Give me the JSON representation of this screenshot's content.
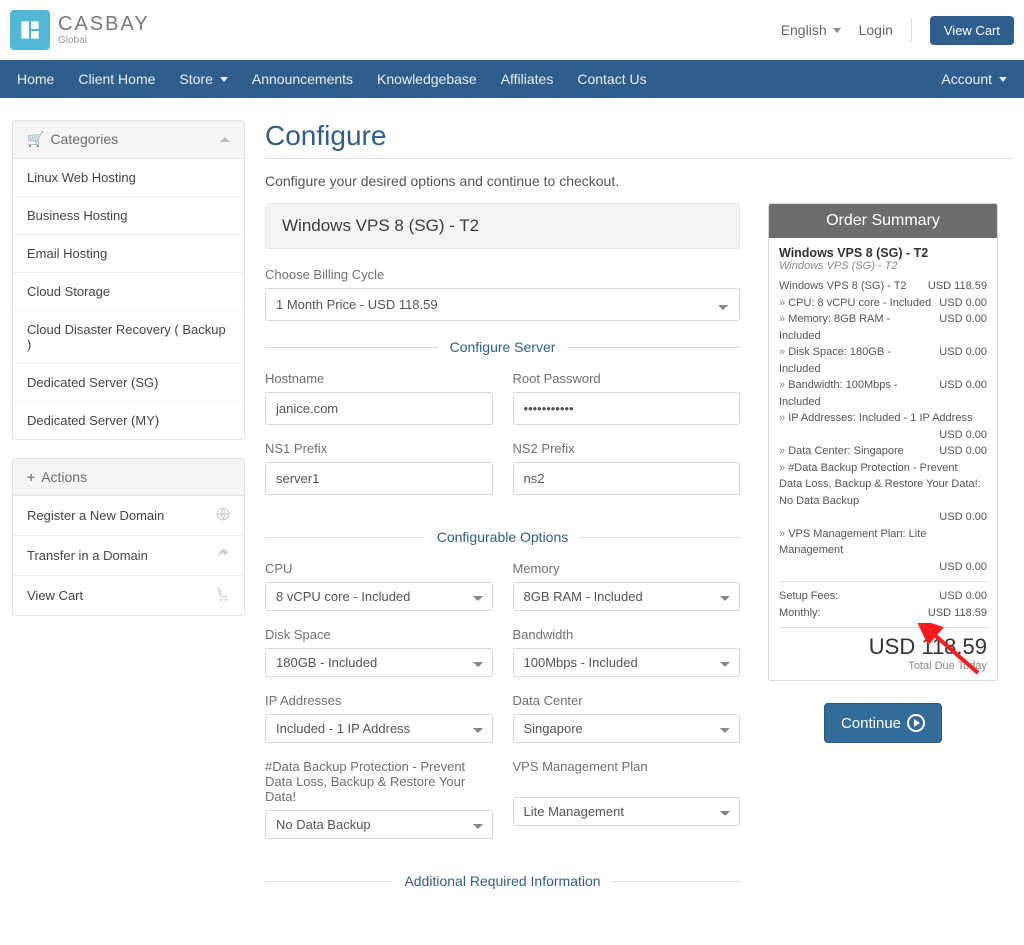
{
  "topbar": {
    "brand_main": "CASBAY",
    "brand_sub": "Global",
    "language": "English",
    "login": "Login",
    "view_cart": "View Cart"
  },
  "nav": {
    "home": "Home",
    "client_home": "Client Home",
    "store": "Store",
    "announcements": "Announcements",
    "knowledgebase": "Knowledgebase",
    "affiliates": "Affiliates",
    "contact": "Contact Us",
    "account": "Account"
  },
  "sidebar": {
    "categories_title": "Categories",
    "categories": [
      "Linux Web Hosting",
      "Business Hosting",
      "Email Hosting",
      "Cloud Storage",
      "Cloud Disaster Recovery ( Backup )",
      "Dedicated Server (SG)",
      "Dedicated Server (MY)"
    ],
    "actions_title": "Actions",
    "actions": [
      "Register a New Domain",
      "Transfer in a Domain",
      "View Cart"
    ]
  },
  "page": {
    "title": "Configure",
    "subtitle": "Configure your desired options and continue to checkout.",
    "product": "Windows VPS 8 (SG) - T2",
    "billing_label": "Choose Billing Cycle",
    "billing_value": "1 Month Price - USD 118.59",
    "sec_server": "Configure Server",
    "hostname_label": "Hostname",
    "hostname_value": "janice.com",
    "rootpw_label": "Root Password",
    "rootpw_value": "•••••••••••",
    "ns1_label": "NS1 Prefix",
    "ns1_value": "server1",
    "ns2_label": "NS2 Prefix",
    "ns2_value": "ns2",
    "sec_options": "Configurable Options",
    "cpu_label": "CPU",
    "cpu_value": "8 vCPU core - Included",
    "mem_label": "Memory",
    "mem_value": "8GB RAM - Included",
    "disk_label": "Disk Space",
    "disk_value": "180GB - Included",
    "bw_label": "Bandwidth",
    "bw_value": "100Mbps - Included",
    "ip_label": "IP Addresses",
    "ip_value": "Included - 1 IP Address",
    "dc_label": "Data Center",
    "dc_value": "Singapore",
    "backup_label": "#Data Backup Protection - Prevent Data Loss, Backup & Restore Your Data!",
    "backup_value": "No Data Backup",
    "mgmt_label": "VPS Management Plan",
    "mgmt_value": "Lite Management",
    "sec_additional": "Additional Required Information"
  },
  "summary": {
    "title": "Order Summary",
    "product_title": "Windows VPS 8 (SG) - T2",
    "product_sub": "Windows VPS (SG) - T2",
    "lines": [
      {
        "l": "Windows VPS 8 (SG) - T2",
        "r": "USD 118.59",
        "indent": false
      },
      {
        "l": "CPU: 8 vCPU core - Included",
        "r": "USD 0.00",
        "indent": true
      },
      {
        "l": "Memory: 8GB RAM - Included",
        "r": "USD 0.00",
        "indent": true
      },
      {
        "l": "Disk Space: 180GB - Included",
        "r": "USD 0.00",
        "indent": true
      },
      {
        "l": "Bandwidth: 100Mbps - Included",
        "r": "USD 0.00",
        "indent": true
      },
      {
        "l": "IP Addresses: Included - 1 IP Address",
        "r": "",
        "indent": true
      },
      {
        "l": "",
        "r": "USD 0.00",
        "indent": false
      },
      {
        "l": "Data Center: Singapore",
        "r": "USD 0.00",
        "indent": true
      },
      {
        "l": "#Data Backup Protection - Prevent Data Loss, Backup & Restore Your Data!: No Data Backup",
        "r": "",
        "indent": true
      },
      {
        "l": "",
        "r": "USD 0.00",
        "indent": false
      },
      {
        "l": "VPS Management Plan: Lite Management",
        "r": "",
        "indent": true
      },
      {
        "l": "",
        "r": "USD 0.00",
        "indent": false
      }
    ],
    "setup_label": "Setup Fees:",
    "setup_value": "USD 0.00",
    "monthly_label": "Monthly:",
    "monthly_value": "USD 118.59",
    "total": "USD 118.59",
    "total_label": "Total Due Today",
    "continue": "Continue"
  }
}
